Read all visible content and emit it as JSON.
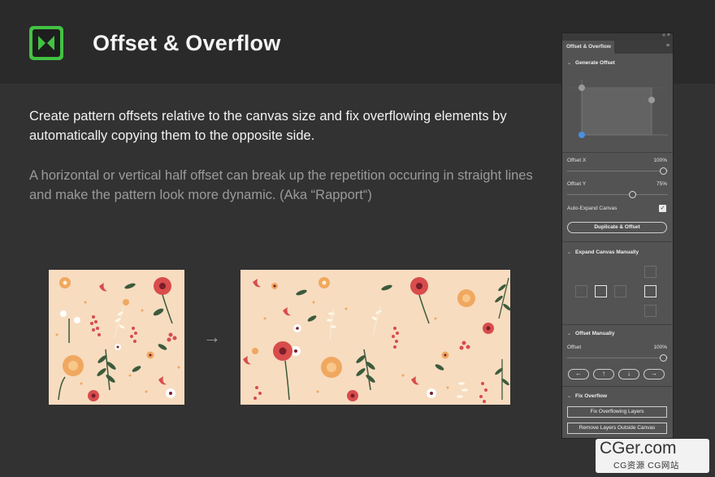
{
  "header": {
    "title": "Offset & Overflow",
    "logo_icon": "extension-logo-icon",
    "accent": "#43c243"
  },
  "description": {
    "line1": "Create pattern offsets relative to the canvas size and fix overflowing elements by automatically copying them to the opposite side.",
    "line2": "A horizontal or vertical half offset can break up the repetition occuring in straight lines and make the pattern look more dynamic. (Aka “Rapport“)"
  },
  "illustration": {
    "arrow": "→",
    "pattern_background": "#f7dcc0"
  },
  "panel": {
    "top_controls": "« ×",
    "tab_label": "Offset & Overflow",
    "menu_icon": "≡",
    "generate_offset": {
      "heading": "Generate Offset",
      "offset_x_label": "Offset X",
      "offset_x_value": "100%",
      "offset_x_level": 1.0,
      "offset_y_label": "Offset Y",
      "offset_y_value": "75%",
      "offset_y_level": 0.75,
      "auto_expand_label": "Auto-Expand Canvas",
      "auto_expand_checked": true,
      "duplicate_button": "Duplicate & Offset"
    },
    "expand_canvas": {
      "heading": "Expand Canvas Manually"
    },
    "offset_manually": {
      "heading": "Offset Manually",
      "offset_label": "Offset",
      "offset_value": "100%",
      "offset_level": 1.0,
      "arrows": [
        "←",
        "↑",
        "↓",
        "→"
      ]
    },
    "fix_overflow": {
      "heading": "Fix Overflow",
      "fix_button": "Fix Overflowing Layers",
      "remove_button": "Remove Layers Outside Canvas"
    }
  },
  "watermark": {
    "logo": "CGer.com",
    "sub": "CG资源 CG网站"
  }
}
